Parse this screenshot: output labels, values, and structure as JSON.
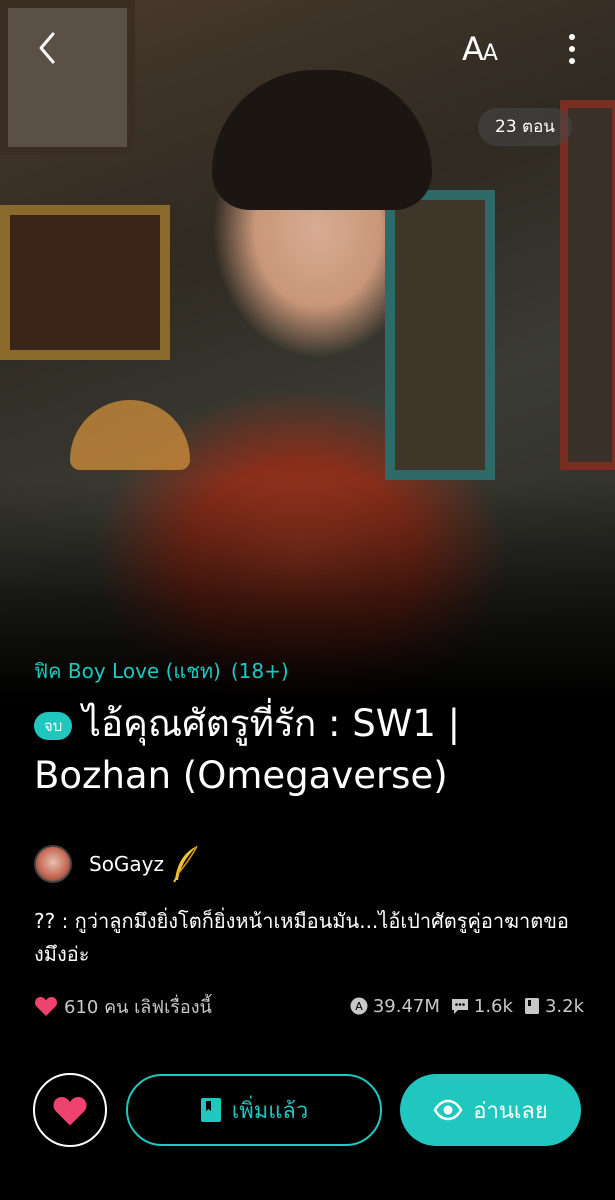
{
  "header": {
    "font_size_label": "A",
    "font_size_label_small": "A",
    "back_icon": "chevron-left-icon",
    "more_icon": "more-vertical-icon"
  },
  "cover": {
    "episode_count": "23 ตอน"
  },
  "story": {
    "genre": "ฟิค Boy Love (แชท)",
    "age_rating": "(18+)",
    "status_badge": "จบ",
    "title": "ไอ้คุณศัตรูที่รัก : SW1 | Bozhan (Omegaverse)",
    "author": "SoGayz",
    "description": "?? : กูว่าลูกมึงยิ่งโตก็ยิ่งหน้าเหมือนมัน...ไอ้เป่าศัตรูคู่อาฆาตของมึงอ่ะ"
  },
  "stats": {
    "likes": "610 คน เลิฟเรื่องนี้",
    "views": "39.47M",
    "comments": "1.6k",
    "saves": "3.2k"
  },
  "actions": {
    "add_label": "เพิ่มแล้ว",
    "read_label": "อ่านเลย"
  },
  "colors": {
    "accent": "#20c7bf",
    "heart": "#f0426f",
    "background": "#000000"
  }
}
